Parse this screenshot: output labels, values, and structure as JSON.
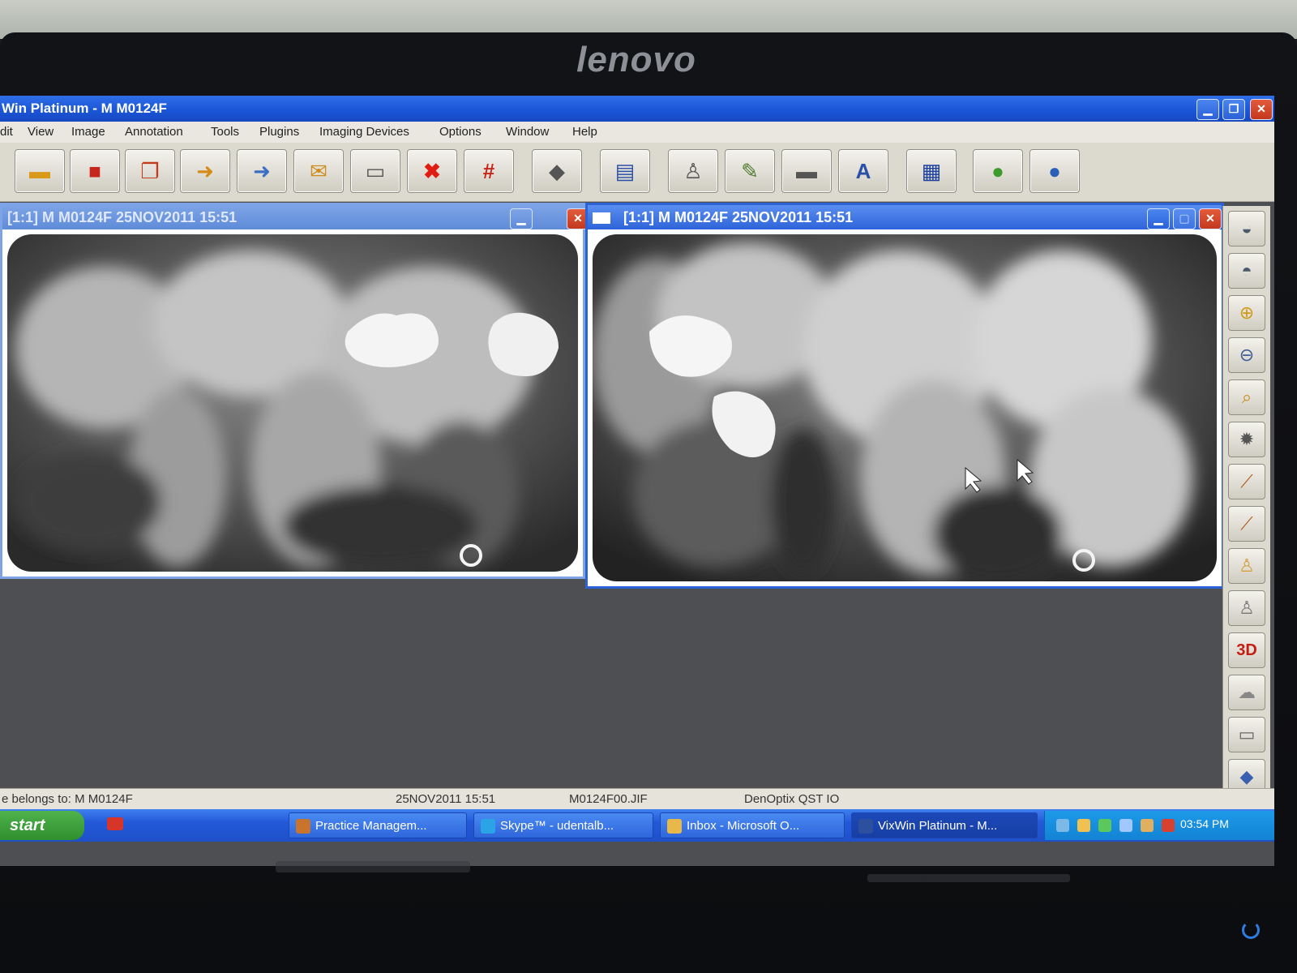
{
  "monitor": {
    "brand": "lenovo"
  },
  "app": {
    "title": "Win Platinum - M M0124F",
    "controls": {
      "minimize": "▁",
      "maximize": "❐",
      "close": "✕"
    }
  },
  "menu": [
    "dit",
    "View",
    "Image",
    "Annotation",
    "Tools",
    "Plugins",
    "Imaging Devices",
    "Options",
    "Window",
    "Help"
  ],
  "toolbar_icons": [
    "open-folder-icon",
    "save-icon",
    "copy-stack-icon",
    "import-icon",
    "export-icon",
    "email-icon",
    "print-icon",
    "delete-icon",
    "hash-icon",
    "eraser-icon",
    "scanner-icon",
    "tooth-icon",
    "pencil-icon",
    "ruler-icon",
    "text-icon",
    "keyboard-icon",
    "help-icon",
    "info-icon"
  ],
  "image_windows": [
    {
      "title": "[1:1] M M0124F  25NOV2011 15:51"
    },
    {
      "title": "[1:1] M M0124F  25NOV2011 15:51"
    }
  ],
  "sidebar_icons": [
    "contrast-icon",
    "sharpen-icon",
    "zoom-in-icon",
    "zoom-out-icon",
    "zoom-window-icon",
    "brightness-icon",
    "measure-icon",
    "calibrate-icon",
    "tooth-icon",
    "tooth-search-icon",
    "3d-icon",
    "cloud-icon",
    "book-icon",
    "shield-icon"
  ],
  "sidebar_3d_label": "3D",
  "status": {
    "owner": "e belongs to: M M0124F",
    "datetime": "25NOV2011 15:51",
    "filename": "M0124F00.JIF",
    "device": "DenOptix QST IO"
  },
  "taskbar": {
    "start": "start",
    "tasks": [
      {
        "label": "Practice Managem...",
        "color": "#c8742c"
      },
      {
        "label": "Skype™ - udentalb...",
        "color": "#2aa4e6"
      },
      {
        "label": "Inbox - Microsoft O...",
        "color": "#e8b84a"
      },
      {
        "label": "VixWin Platinum - M...",
        "color": "#2c4f9e"
      }
    ],
    "clock": "03:54 PM"
  }
}
